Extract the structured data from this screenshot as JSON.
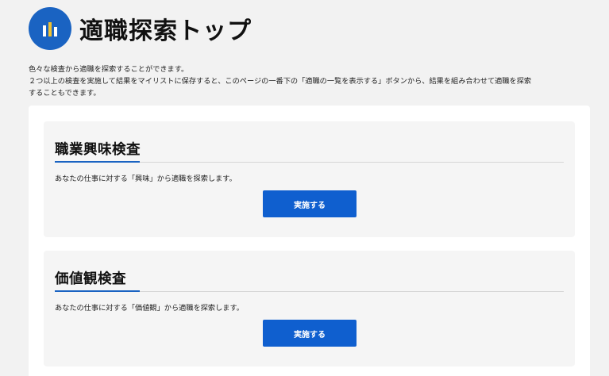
{
  "header": {
    "title": "適職探索トップ",
    "logo_icon": "bar-chart-icon",
    "logo_color": "#1a63c2",
    "logo_bar_colors": [
      "#ffffff",
      "#f2c230",
      "#ffffff"
    ]
  },
  "intro": {
    "line1": "色々な検査から適職を探索することができます。",
    "line2": "２つ以上の検査を実施して結果をマイリストに保存すると、このページの一番下の「適職の一覧を表示する」ボタンから、結果を組み合わせて適職を探索",
    "line3": "することもできます。"
  },
  "cards": [
    {
      "title": "職業興味検査",
      "description": "あなたの仕事に対する「興味」から適職を探索します。",
      "button_label": "実施する"
    },
    {
      "title": "価値観検査",
      "description": "あなたの仕事に対する「価値観」から適職を探索します。",
      "button_label": "実施する"
    }
  ],
  "colors": {
    "accent": "#1a63c2",
    "button": "#0f5fcf",
    "background": "#f2f2f2"
  }
}
